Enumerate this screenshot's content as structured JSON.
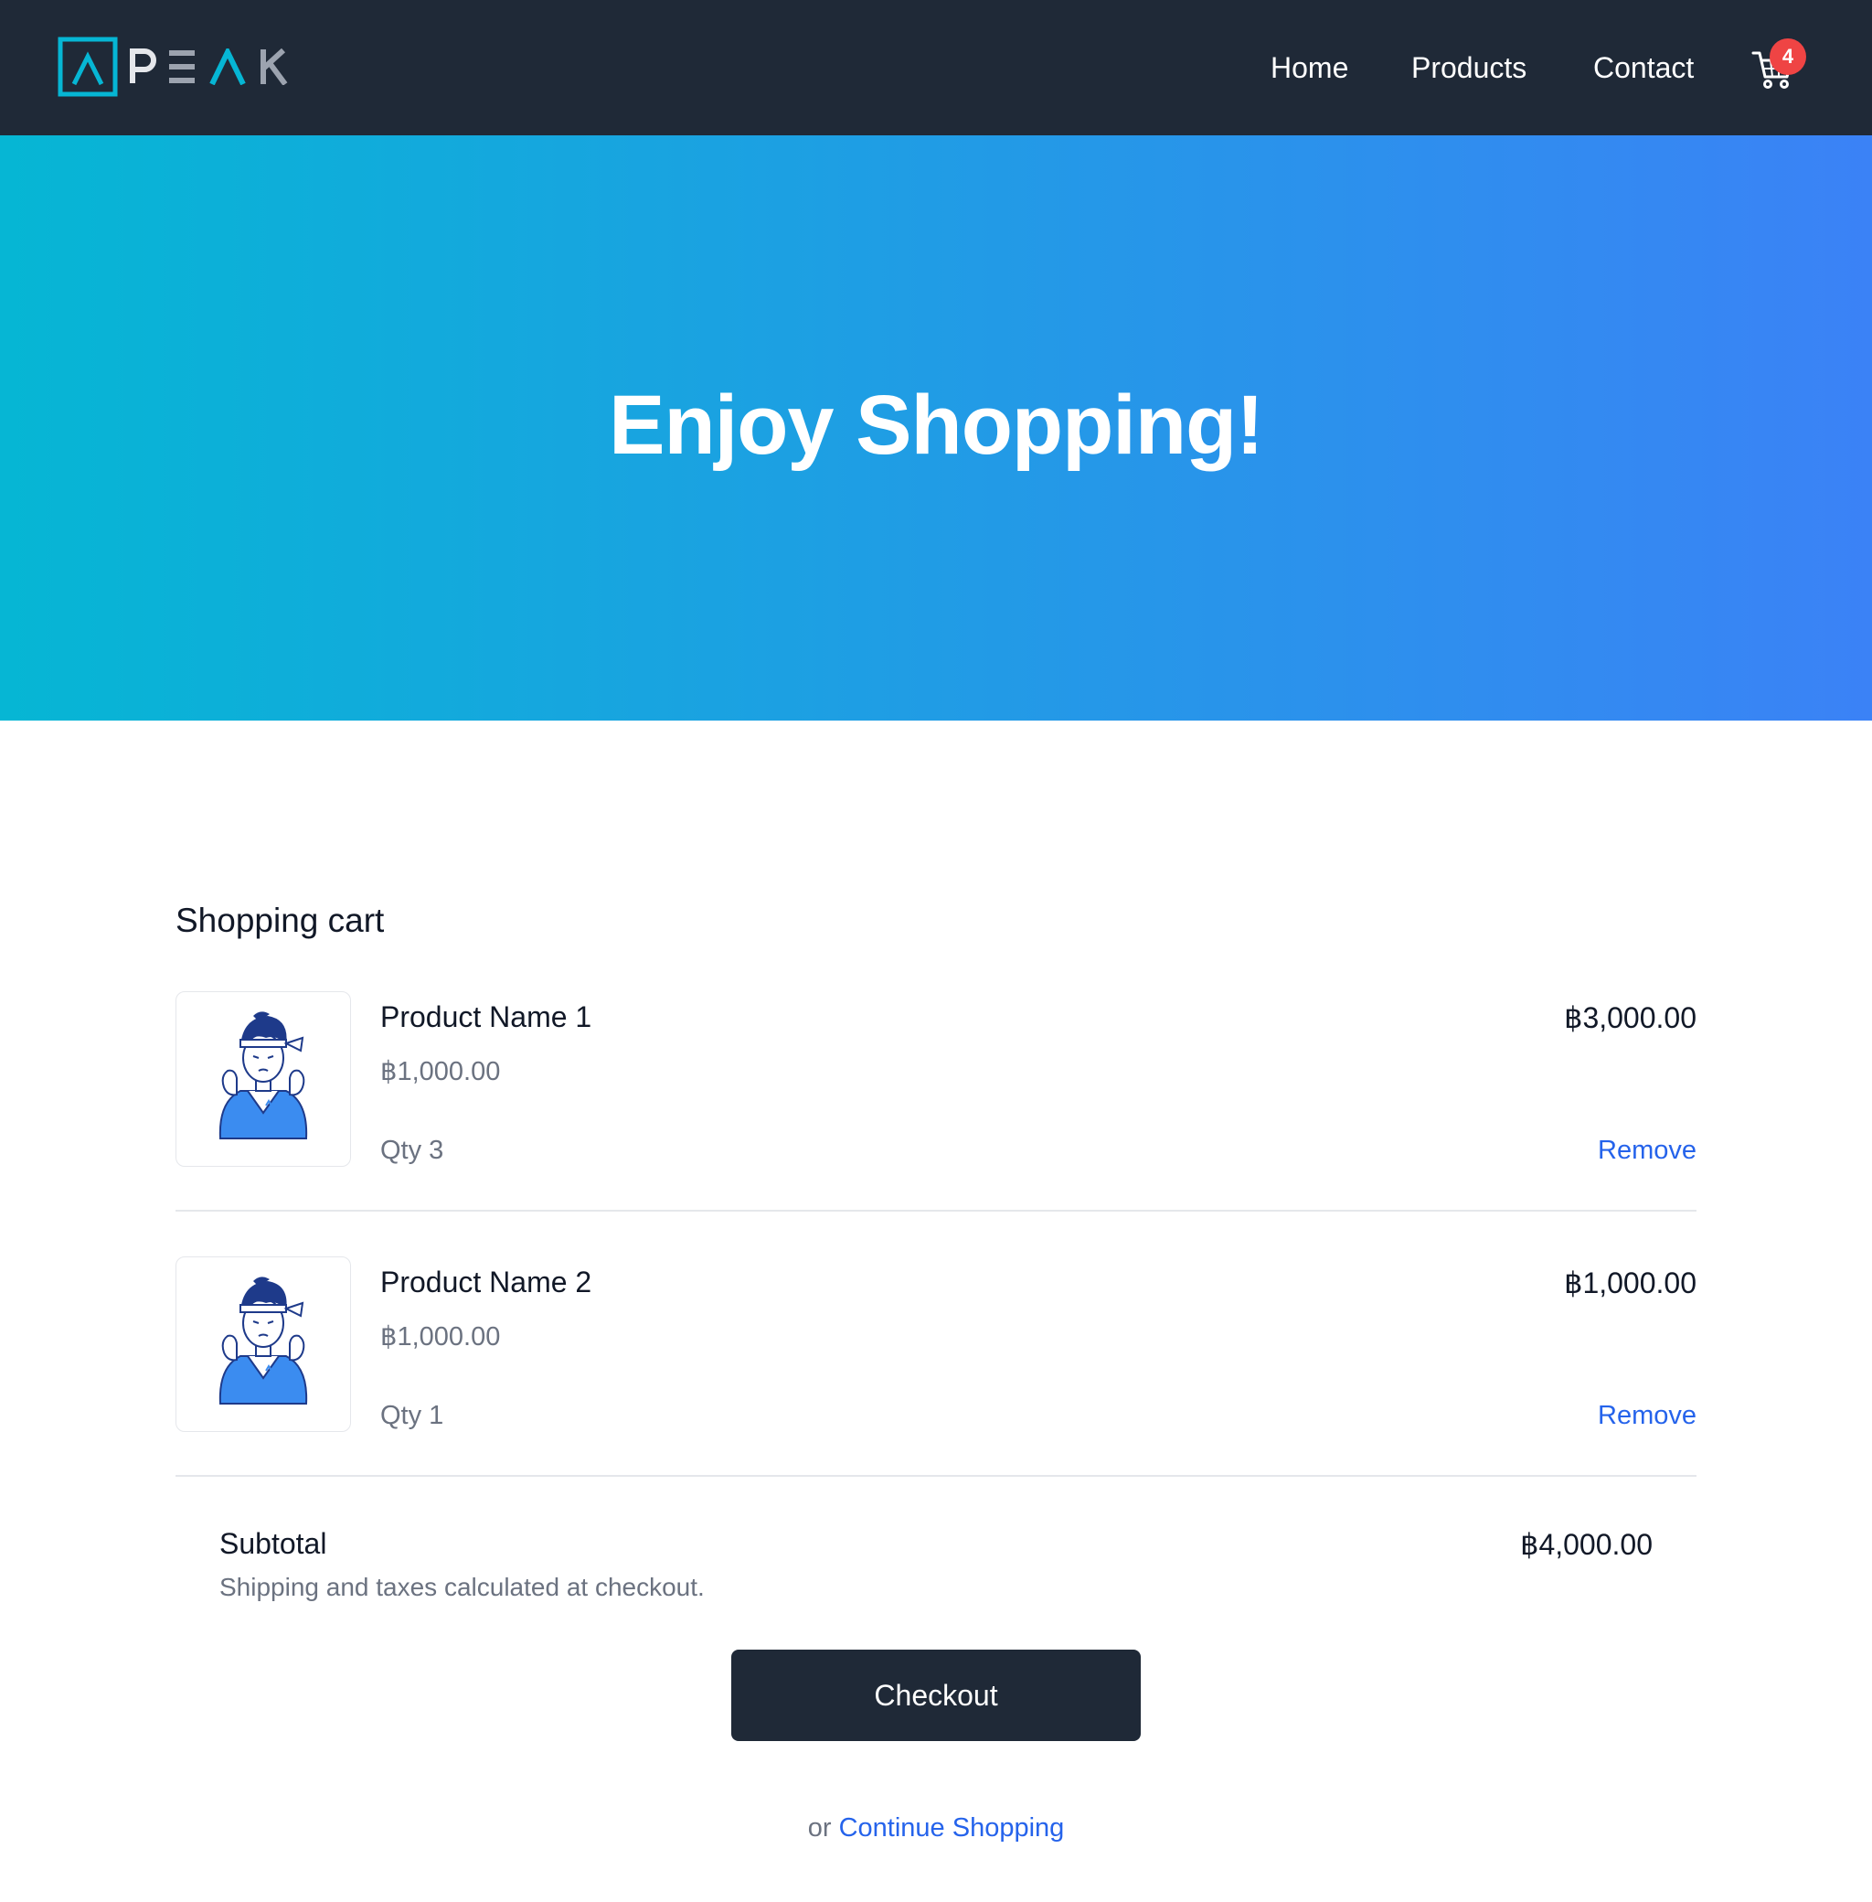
{
  "brand": {
    "name": "PEAK"
  },
  "nav": {
    "links": [
      {
        "label": "Home"
      },
      {
        "label": "Products"
      },
      {
        "label": "Contact"
      }
    ],
    "cart_count": "4"
  },
  "hero": {
    "title": "Enjoy Shopping!"
  },
  "cart": {
    "title": "Shopping cart",
    "items": [
      {
        "name": "Product Name 1",
        "unit_price": "฿1,000.00",
        "qty": "Qty 3",
        "total": "฿3,000.00",
        "remove_label": "Remove",
        "image_icon": "character-illustration"
      },
      {
        "name": "Product Name 2",
        "unit_price": "฿1,000.00",
        "qty": "Qty 1",
        "total": "฿1,000.00",
        "remove_label": "Remove",
        "image_icon": "character-illustration"
      }
    ],
    "subtotal_label": "Subtotal",
    "subtotal_value": "฿4,000.00",
    "subtotal_note": "Shipping and taxes calculated at checkout.",
    "checkout_label": "Checkout",
    "continue_prefix": "or",
    "continue_label": "Continue Shopping"
  },
  "colors": {
    "nav_bg": "#1f2937",
    "hero_gradient_start": "#06b6d4",
    "hero_gradient_end": "#3b82f6",
    "accent_link": "#2563eb",
    "badge": "#ef4444"
  }
}
